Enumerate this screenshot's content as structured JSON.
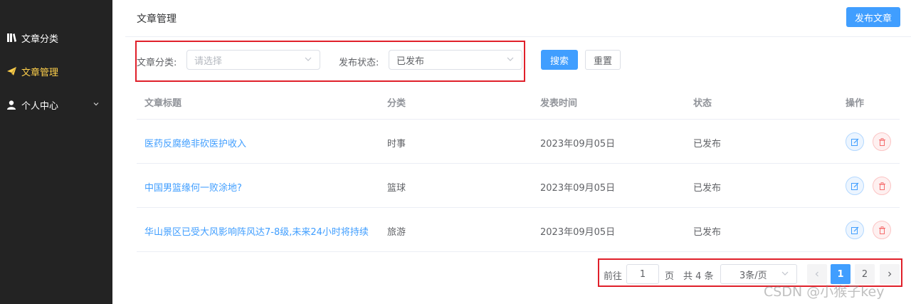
{
  "sidebar": {
    "items": [
      {
        "label": "文章分类",
        "icon": "book-icon"
      },
      {
        "label": "文章管理",
        "icon": "send-icon",
        "active": true
      },
      {
        "label": "个人中心",
        "icon": "user-icon",
        "expandable": true
      }
    ]
  },
  "header": {
    "title": "文章管理",
    "publish_label": "发布文章"
  },
  "filters": {
    "category_label": "文章分类:",
    "category_placeholder": "请选择",
    "status_label": "发布状态:",
    "status_value": "已发布",
    "search_label": "搜索",
    "reset_label": "重置"
  },
  "table": {
    "headers": [
      "文章标题",
      "分类",
      "发表时间",
      "状态",
      "操作"
    ],
    "rows": [
      {
        "title": "医药反腐绝非砍医护收入",
        "category": "时事",
        "date": "2023年09月05日",
        "status": "已发布"
      },
      {
        "title": "中国男篮缘何一败涂地?",
        "category": "篮球",
        "date": "2023年09月05日",
        "status": "已发布"
      },
      {
        "title": "华山景区已受大风影响阵风达7-8级,未来24小时将持续",
        "category": "旅游",
        "date": "2023年09月05日",
        "status": "已发布"
      }
    ]
  },
  "pagination": {
    "goto_prefix": "前往",
    "goto_value": "1",
    "goto_suffix": "页",
    "total_text": "共 4 条",
    "page_size": "3条/页",
    "pages": [
      "1",
      "2"
    ],
    "current_page": 1
  },
  "watermark": "CSDN @小猴子key",
  "colors": {
    "primary": "#409eff",
    "sidebar_bg": "#232323",
    "active_menu": "#ffd04b",
    "danger": "#f56c6c",
    "highlight_box": "#e0202a"
  }
}
